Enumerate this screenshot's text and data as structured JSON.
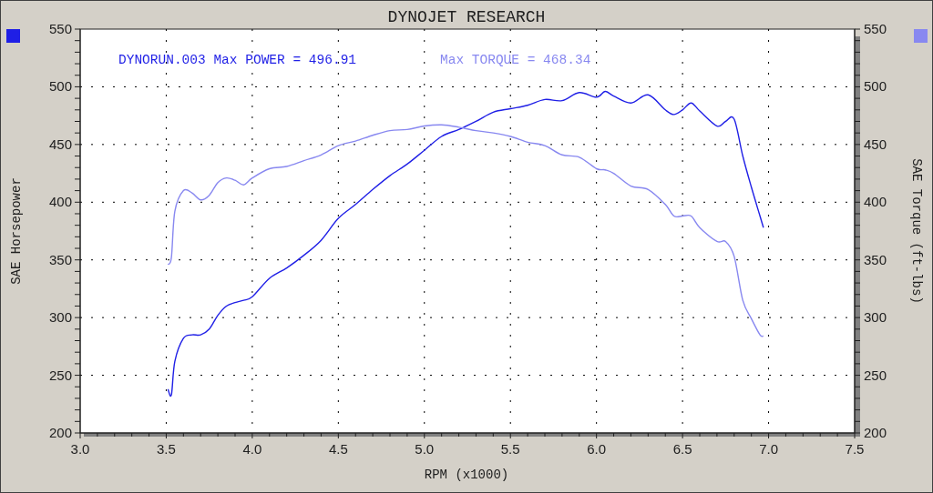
{
  "chart_data": {
    "type": "line",
    "title": "DYNOJET RESEARCH",
    "xlabel": "RPM (x1000)",
    "ylabel": "SAE Horsepower",
    "x": [
      3.51,
      3.53,
      3.55,
      3.6,
      3.65,
      3.7,
      3.75,
      3.8,
      3.85,
      3.9,
      3.95,
      4.0,
      4.1,
      4.2,
      4.3,
      4.4,
      4.5,
      4.6,
      4.7,
      4.8,
      4.9,
      5.0,
      5.1,
      5.2,
      5.3,
      5.4,
      5.5,
      5.6,
      5.7,
      5.8,
      5.9,
      6.0,
      6.05,
      6.1,
      6.2,
      6.3,
      6.4,
      6.45,
      6.5,
      6.55,
      6.6,
      6.7,
      6.75,
      6.8,
      6.85,
      6.9,
      6.95,
      6.97
    ],
    "series": [
      {
        "name": "DYNORUN.003 Max POWER = 496.91",
        "color": "#1f1fe6",
        "values": [
          238,
          233,
          262,
          282,
          285,
          285,
          290,
          302,
          310,
          313,
          315,
          318,
          334,
          343,
          354,
          367,
          386,
          398,
          411,
          423,
          433,
          445,
          457,
          463,
          470,
          478,
          481,
          484,
          489,
          488,
          495,
          491,
          496,
          492,
          486,
          493,
          480,
          476,
          480,
          486,
          479,
          466,
          470,
          472,
          440,
          413,
          388,
          378
        ]
      },
      {
        "name": "Max TORQUE = 468.34",
        "color": "#8888f0",
        "values": [
          346,
          352,
          392,
          410,
          408,
          402,
          406,
          417,
          421,
          419,
          415,
          421,
          429,
          431,
          436,
          441,
          449,
          453,
          458,
          462,
          463,
          466,
          467,
          465,
          462,
          460,
          457,
          452,
          449,
          441,
          439,
          429,
          428,
          425,
          414,
          411,
          398,
          388,
          388,
          388,
          378,
          366,
          366,
          353,
          315,
          299,
          285,
          284
        ]
      }
    ],
    "xlim": [
      3.0,
      7.5
    ],
    "ylim": [
      200,
      550
    ],
    "xticks": [
      {
        "value": 3.0,
        "label": "3.0"
      },
      {
        "value": 3.5,
        "label": "3.5"
      },
      {
        "value": 4.0,
        "label": "4.0"
      },
      {
        "value": 4.5,
        "label": "4.5"
      },
      {
        "value": 5.0,
        "label": "5.0"
      },
      {
        "value": 5.5,
        "label": "5.5"
      },
      {
        "value": 6.0,
        "label": "6.0"
      },
      {
        "value": 6.5,
        "label": "6.5"
      },
      {
        "value": 7.0,
        "label": "7.0"
      },
      {
        "value": 7.5,
        "label": "7.5"
      }
    ],
    "yticks": [
      200,
      250,
      300,
      350,
      400,
      450,
      500,
      550
    ],
    "grid": true
  },
  "right_axis": {
    "label": "SAE Torque (ft-lbs)",
    "ticks": [
      "550",
      "500",
      "450",
      "400",
      "350",
      "300",
      "250",
      "200"
    ]
  }
}
